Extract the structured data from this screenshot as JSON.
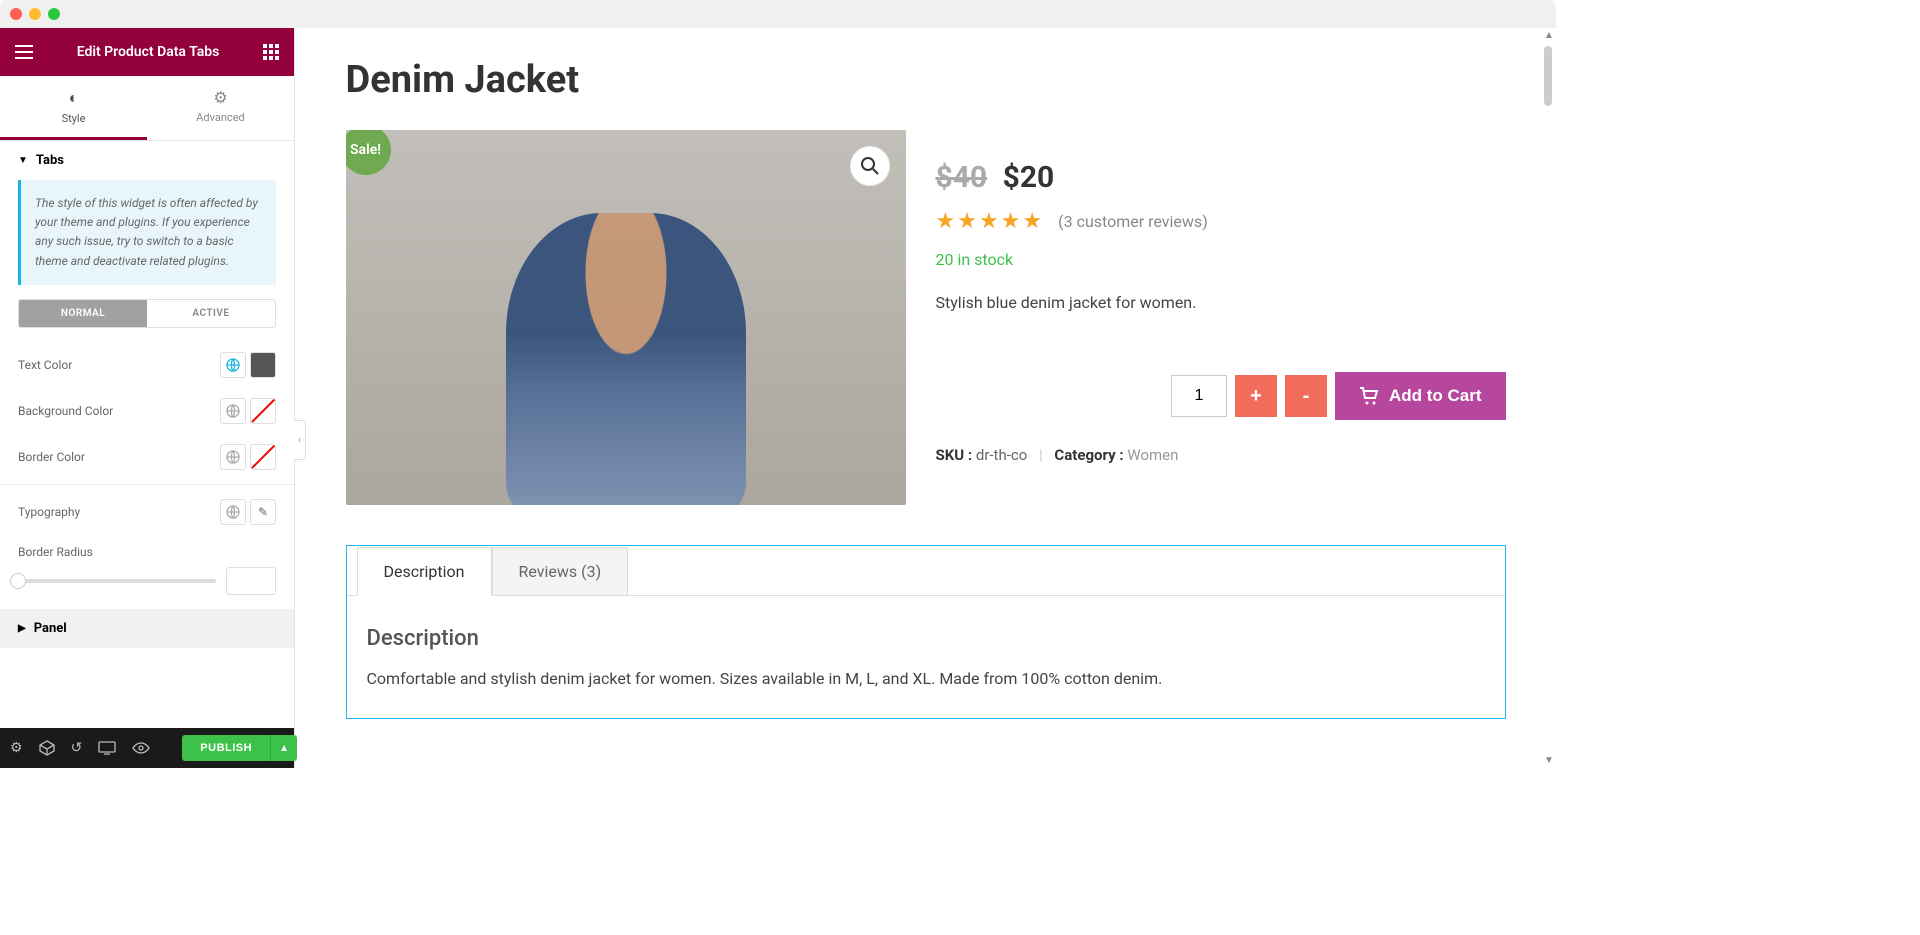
{
  "sidebar": {
    "title": "Edit Product Data Tabs",
    "tabs": {
      "style": "Style",
      "advanced": "Advanced"
    },
    "sections": {
      "tabs_label": "Tabs",
      "panel_label": "Panel"
    },
    "notice": "The style of this widget is often affected by your theme and plugins. If you experience any such issue, try to switch to a basic theme and deactivate related plugins.",
    "state_toggle": {
      "normal": "NORMAL",
      "active": "ACTIVE"
    },
    "controls": {
      "text_color": "Text Color",
      "background_color": "Background Color",
      "border_color": "Border Color",
      "typography": "Typography",
      "border_radius": "Border Radius"
    },
    "footer": {
      "publish": "PUBLISH"
    }
  },
  "product": {
    "title": "Denim Jacket",
    "sale_badge": "Sale!",
    "price_old": "$40",
    "price_new": "$20",
    "reviews_text": "(3 customer reviews)",
    "stock_text": "20 in stock",
    "short_desc": "Stylish blue denim jacket for women.",
    "qty": "1",
    "add_to_cart": "Add to Cart",
    "sku_label": "SKU :",
    "sku_value": "dr-th-co",
    "category_label": "Category :",
    "category_value": "Women"
  },
  "tabs": {
    "items": [
      {
        "label": "Description"
      },
      {
        "label": "Reviews (3)"
      }
    ],
    "content_heading": "Description",
    "content_body": "Comfortable and stylish denim jacket for women. Sizes available in M, L, and XL. Made from 100% cotton denim."
  }
}
